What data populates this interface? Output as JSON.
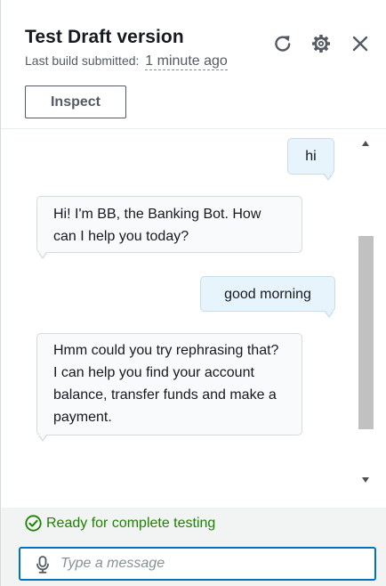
{
  "header": {
    "title": "Test Draft version",
    "subtitle_label": "Last build submitted:",
    "subtitle_time": "1 minute ago",
    "inspect_label": "Inspect",
    "icons": [
      "refresh-icon",
      "gear-icon",
      "close-icon"
    ]
  },
  "messages": [
    {
      "sender": "user",
      "text": "hi"
    },
    {
      "sender": "bot",
      "text": "Hi! I'm BB, the Banking Bot. How can I help you today?"
    },
    {
      "sender": "user",
      "text": "good morning"
    },
    {
      "sender": "bot",
      "text": "Hmm could you try rephrasing that? I can help you find your account balance, transfer funds and make a payment."
    }
  ],
  "footer": {
    "status": "Ready for complete testing",
    "input_value": "",
    "input_placeholder": "Type a message"
  },
  "colors": {
    "accent": "#0073bb",
    "status_green": "#1d8102",
    "user_bubble": "#e8f4fc",
    "bot_bubble": "#f8fafc"
  }
}
